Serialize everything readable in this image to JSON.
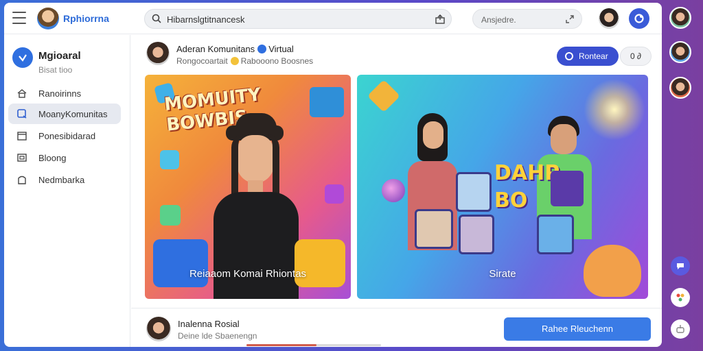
{
  "app": {
    "brand_name": "Rphiorrna"
  },
  "search": {
    "value": "Hibarnslgtitnancesk"
  },
  "top_pill": {
    "text": "Ansjedre."
  },
  "sidebar": {
    "title": "Mgioaral",
    "subtitle": "Bisat tioo",
    "items": [
      {
        "label": "Ranoirinns",
        "icon": "home-icon",
        "active": false
      },
      {
        "label": "MoanyKomunitas",
        "icon": "community-icon",
        "active": true
      },
      {
        "label": "Ponesibidarad",
        "icon": "calendar-icon",
        "active": false
      },
      {
        "label": "Bloong",
        "icon": "blog-icon",
        "active": false
      },
      {
        "label": "Nedmbarka",
        "icon": "bookmark-icon",
        "active": false
      }
    ]
  },
  "post": {
    "author_name": "Aderan Komunitans",
    "author_tag": "Virtual",
    "meta_left": "Rongocoartait",
    "meta_right": "Rabooono Boosnes",
    "follow_label": "Rontear",
    "more_label": "0 ∂"
  },
  "cards": [
    {
      "caption": "Reiaaom Komai Rhiontas",
      "poster_text": "MOMUITY BOWBIS"
    },
    {
      "caption": "Sirate",
      "poster_text": "DAHP BO"
    }
  ],
  "footer": {
    "name": "Inalenna Rosial",
    "subtitle": "Deine lde Sbaenengn",
    "button_label": "Rahee Rleuchenn",
    "progress": 0.52
  },
  "colors": {
    "accent": "#3a4fd0",
    "brand": "#2d6bd8",
    "cta": "#3a7be6"
  }
}
